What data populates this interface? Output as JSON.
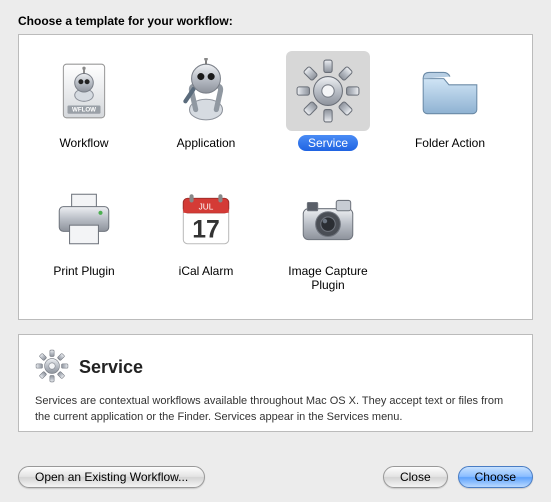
{
  "header": "Choose a template for your workflow:",
  "templates": [
    {
      "id": "workflow",
      "name": "Workflow",
      "icon": "workflow-icon",
      "selected": false
    },
    {
      "id": "application",
      "name": "Application",
      "icon": "app-icon",
      "selected": false
    },
    {
      "id": "service",
      "name": "Service",
      "icon": "gear-icon",
      "selected": true
    },
    {
      "id": "folderaction",
      "name": "Folder Action",
      "icon": "folder-icon",
      "selected": false
    },
    {
      "id": "printplugin",
      "name": "Print Plugin",
      "icon": "printer-icon",
      "selected": false
    },
    {
      "id": "icalalarm",
      "name": "iCal Alarm",
      "icon": "calendar-icon",
      "selected": false
    },
    {
      "id": "imagecapture",
      "name": "Image Capture Plugin",
      "icon": "camera-icon",
      "selected": false
    }
  ],
  "description": {
    "title": "Service",
    "text": "Services are contextual workflows available throughout Mac OS X. They accept text or files from the current application or the Finder. Services appear in the Services menu."
  },
  "buttons": {
    "open": "Open an Existing Workflow...",
    "close": "Close",
    "choose": "Choose"
  },
  "calendar_day": "17",
  "calendar_month": "JUL"
}
